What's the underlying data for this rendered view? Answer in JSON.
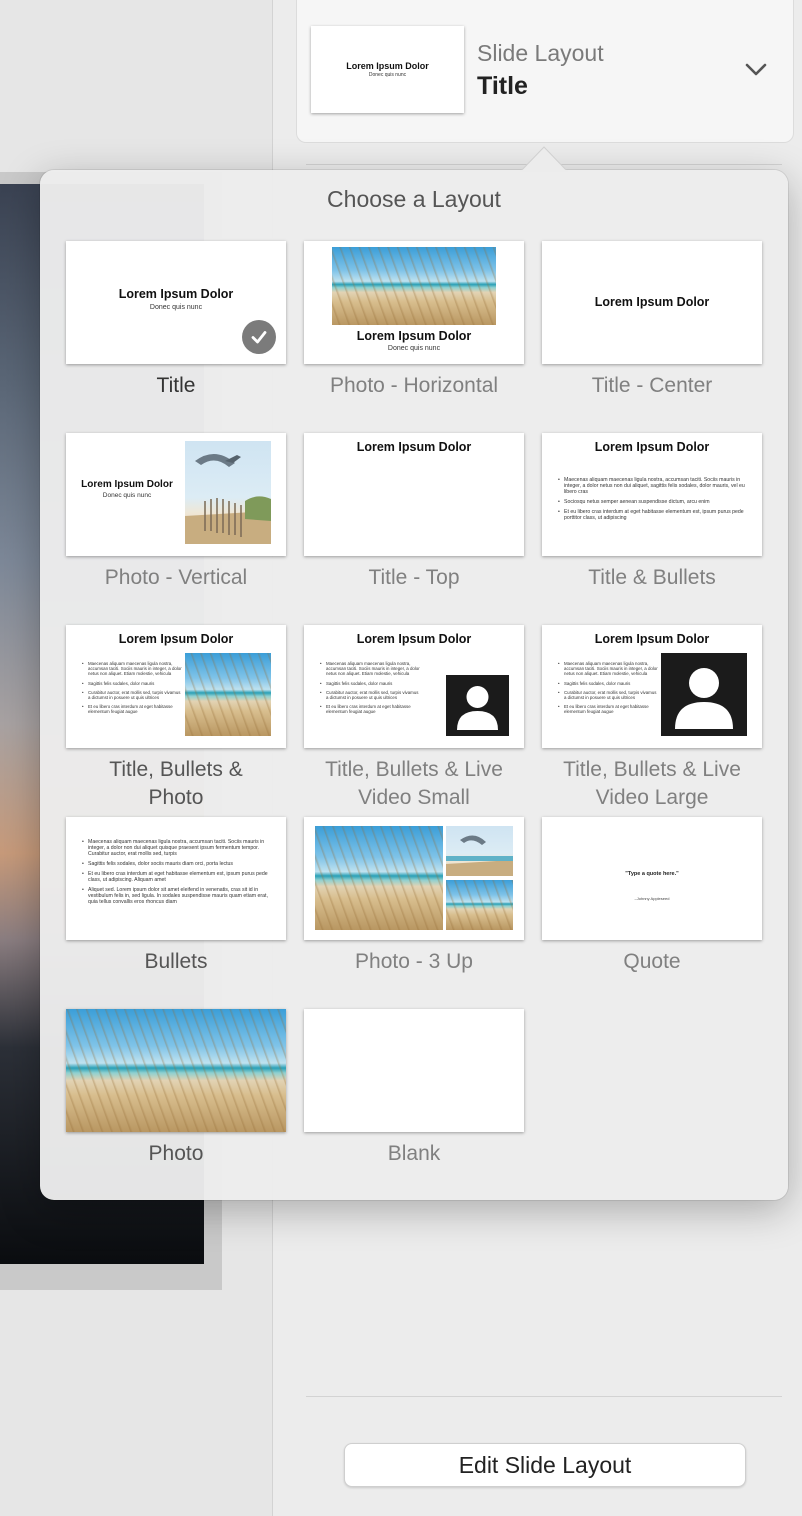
{
  "header": {
    "label": "Slide Layout",
    "value": "Title",
    "thumb_title": "Lorem Ipsum Dolor",
    "thumb_sub": "Donec quis nunc"
  },
  "popover": {
    "title": "Choose a Layout"
  },
  "layouts": {
    "title": "Title",
    "photo_horizontal": "Photo - Horizontal",
    "title_center": "Title - Center",
    "photo_vertical": "Photo - Vertical",
    "title_top": "Title - Top",
    "title_bullets": "Title & Bullets",
    "title_bullets_photo_1": "Title, Bullets &",
    "title_bullets_photo_2": "Photo",
    "tb_live_small_1": "Title, Bullets & Live",
    "tb_live_small_2": "Video Small",
    "tb_live_large_1": "Title, Bullets & Live",
    "tb_live_large_2": "Video Large",
    "bullets": "Bullets",
    "photo_3up": "Photo - 3 Up",
    "quote": "Quote",
    "photo": "Photo",
    "blank": "Blank"
  },
  "thumb_text": {
    "title": "Lorem Ipsum Dolor",
    "sub": "Donec quis nunc",
    "b1_wide": "Maecenas aliquam maecenas ligula nostra, accumsan taciti. Sociis mauris in integer, a dolor netus non dui aliquet, sagittis felis sodales, dolor mauris, vel eu libero cras",
    "b2_wide": "Sociosqu netus semper aenean suspendisse dictum, arcu enim",
    "b3_wide": "Et eu libero cras interdum at eget habitasse elementum est, ipsum purus pede porttitor class, ut adipiscing",
    "b1_narrow": "Maecenas aliquam maecenas ligula nostra, accumsan taciti. Sociis mauris in integer, a dolor netus non aliquet. Etiam molestie, vehicula",
    "b2_narrow": "Sagittis felis sodales, dolor mauris",
    "b3_narrow": "Curabitur auctor, erat mollis sed, turpis vivamus a dictumst in posuere ut quis ultrices",
    "b4_narrow": "Et eu libero cras interdum at eget habitasse elementum feugiat augue",
    "bl1": "Maecenas aliquam maecenas ligula nostra, accumsan taciti. Sociis mauris in integer, a dolor non dui aliquet quisque praesent ipsum fermentum tempor. Curabitur auctor, erat mollis sed, turpis",
    "bl2": "Sagittis felis sodales, dolor sociis mauris diam orci, porta lectus",
    "bl3": "Et eu libero cras interdum at eget habitasse elementum est, ipsum purus pede class, ut adipiscing. Aliquam amet",
    "bl4": "Aliquet sed. Lorem ipsum dolor sit amet eleifend in venenatis, cras sit id in vestibulum felis in, sed ligula. In sodales suspendisse mauris quam etiam erat, quia tellus convallis eros rhoncus diam",
    "quote": "\"Type a quote here.\"",
    "attribution": "–Johnny Appleseed"
  },
  "footer": {
    "edit_button": "Edit Slide Layout"
  }
}
